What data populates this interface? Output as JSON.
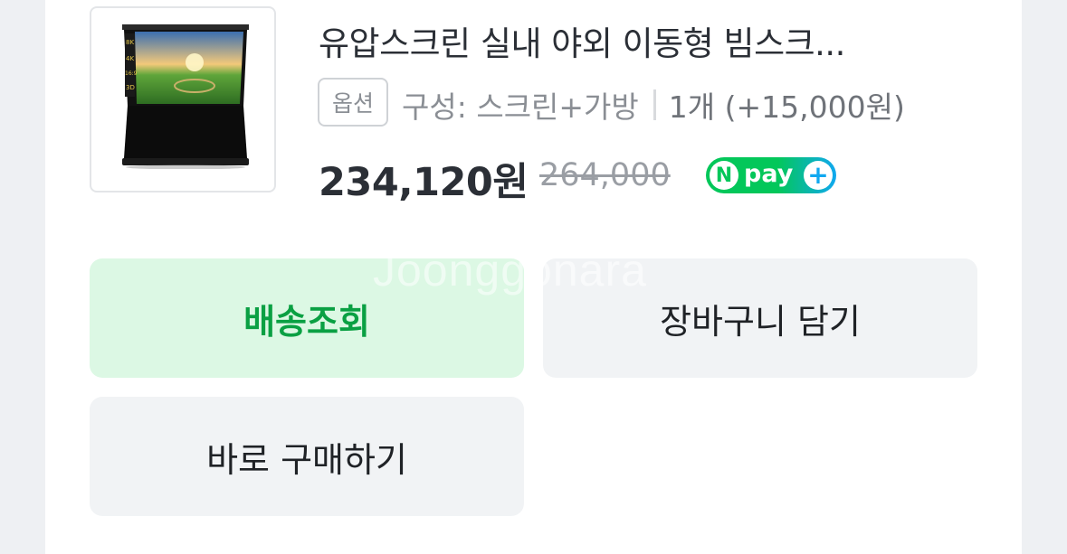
{
  "product": {
    "title": "유압스크린 실내 야외 이동형 빔스크...",
    "option_badge": "옵션",
    "option_label": "구성: 스크린+가방",
    "option_qty": "1개 (+15,000원)",
    "price": "234,120원",
    "original_price": "264,000",
    "image_icon": "projector-screen-image",
    "screen_tags": [
      "8K",
      "4K",
      "16:9",
      "3D"
    ]
  },
  "payment": {
    "badge_letter": "N",
    "badge_text": "pay",
    "badge_plus": "+",
    "colors": {
      "green": "#03c75a",
      "blue": "#10a8f0"
    }
  },
  "buttons": {
    "track": "배송조회",
    "cart": "장바구니 담기",
    "buy": "바로 구매하기"
  },
  "watermark": "Joonggonara",
  "colors": {
    "accent_green": "#0aa043",
    "track_bg": "#dcf8e4",
    "button_bg": "#f1f3f5"
  }
}
